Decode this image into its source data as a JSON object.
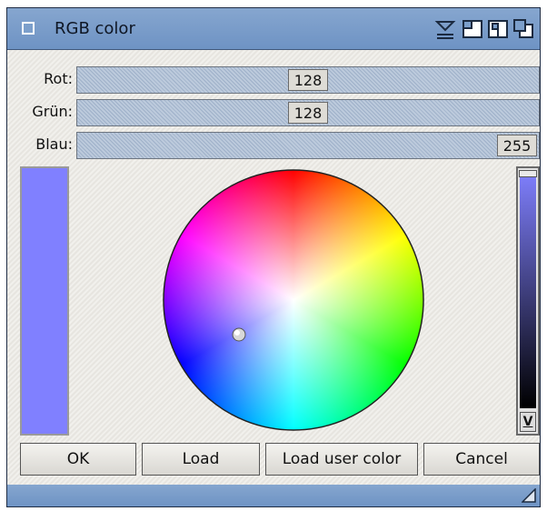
{
  "window": {
    "title": "RGB color"
  },
  "sliders": [
    {
      "label": "Rot:",
      "value": "128",
      "fraction": 0.5
    },
    {
      "label": "Grün:",
      "value": "128",
      "fraction": 0.5
    },
    {
      "label": "Blau:",
      "value": "255",
      "fraction": 1.0
    }
  ],
  "preview": {
    "color": "#8080ff"
  },
  "buttons": {
    "ok": "OK",
    "load": "Load",
    "load_user": "Load user color",
    "cancel": "Cancel"
  },
  "value_slider": {
    "arrow": "V"
  }
}
